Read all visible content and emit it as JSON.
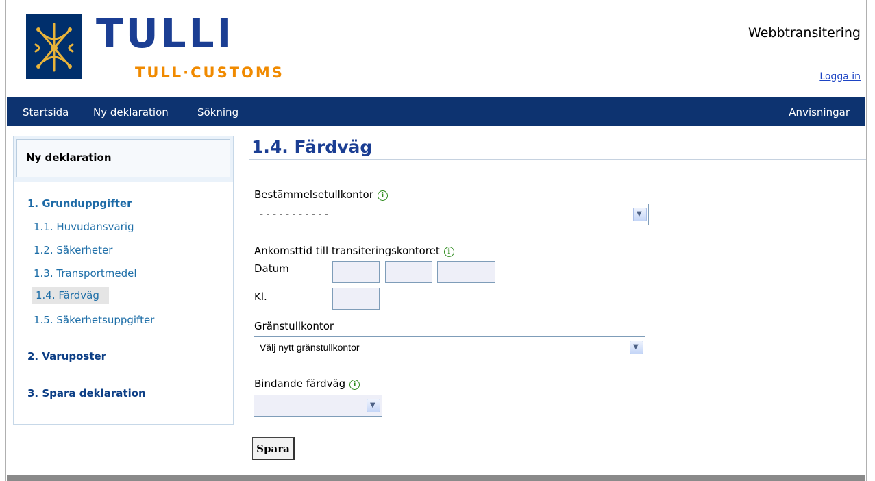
{
  "header": {
    "brand": "TULLI",
    "brand_sub": "TULL·CUSTOMS",
    "site_title": "Webbtransitering",
    "login_link": "Logga in"
  },
  "nav": {
    "items": [
      "Startsida",
      "Ny deklaration",
      "Sökning"
    ],
    "right_item": "Anvisningar"
  },
  "sidebar": {
    "title": "Ny deklaration",
    "section1": "1. Grunduppgifter",
    "items": [
      "1.1. Huvudansvarig",
      "1.2. Säkerheter",
      "1.3. Transportmedel",
      "1.4. Färdväg",
      "1.5. Säkerhetsuppgifter"
    ],
    "section2": "2. Varuposter",
    "section3": "3. Spara deklaration"
  },
  "main": {
    "title": "1.4. Färdväg",
    "dest_label": "Bestämmelsetullkontor",
    "dest_value": "- - - - - - - - - - -",
    "arrival_label": "Ankomsttid till transiteringskontoret",
    "date_label": "Datum",
    "time_label": "Kl.",
    "border_label": "Gränstullkontor",
    "border_value": "Välj nytt gränstullkontor",
    "binding_label": "Bindande färdväg",
    "binding_value": "",
    "save_label": "Spara"
  },
  "icons": {
    "info": "info-icon",
    "dropdown": "chevron-down-icon",
    "logo": "customs-emblem-icon"
  },
  "colors": {
    "brand_blue": "#1b3e93",
    "brand_orange": "#f08a00",
    "nav_bg": "#0d3370"
  }
}
